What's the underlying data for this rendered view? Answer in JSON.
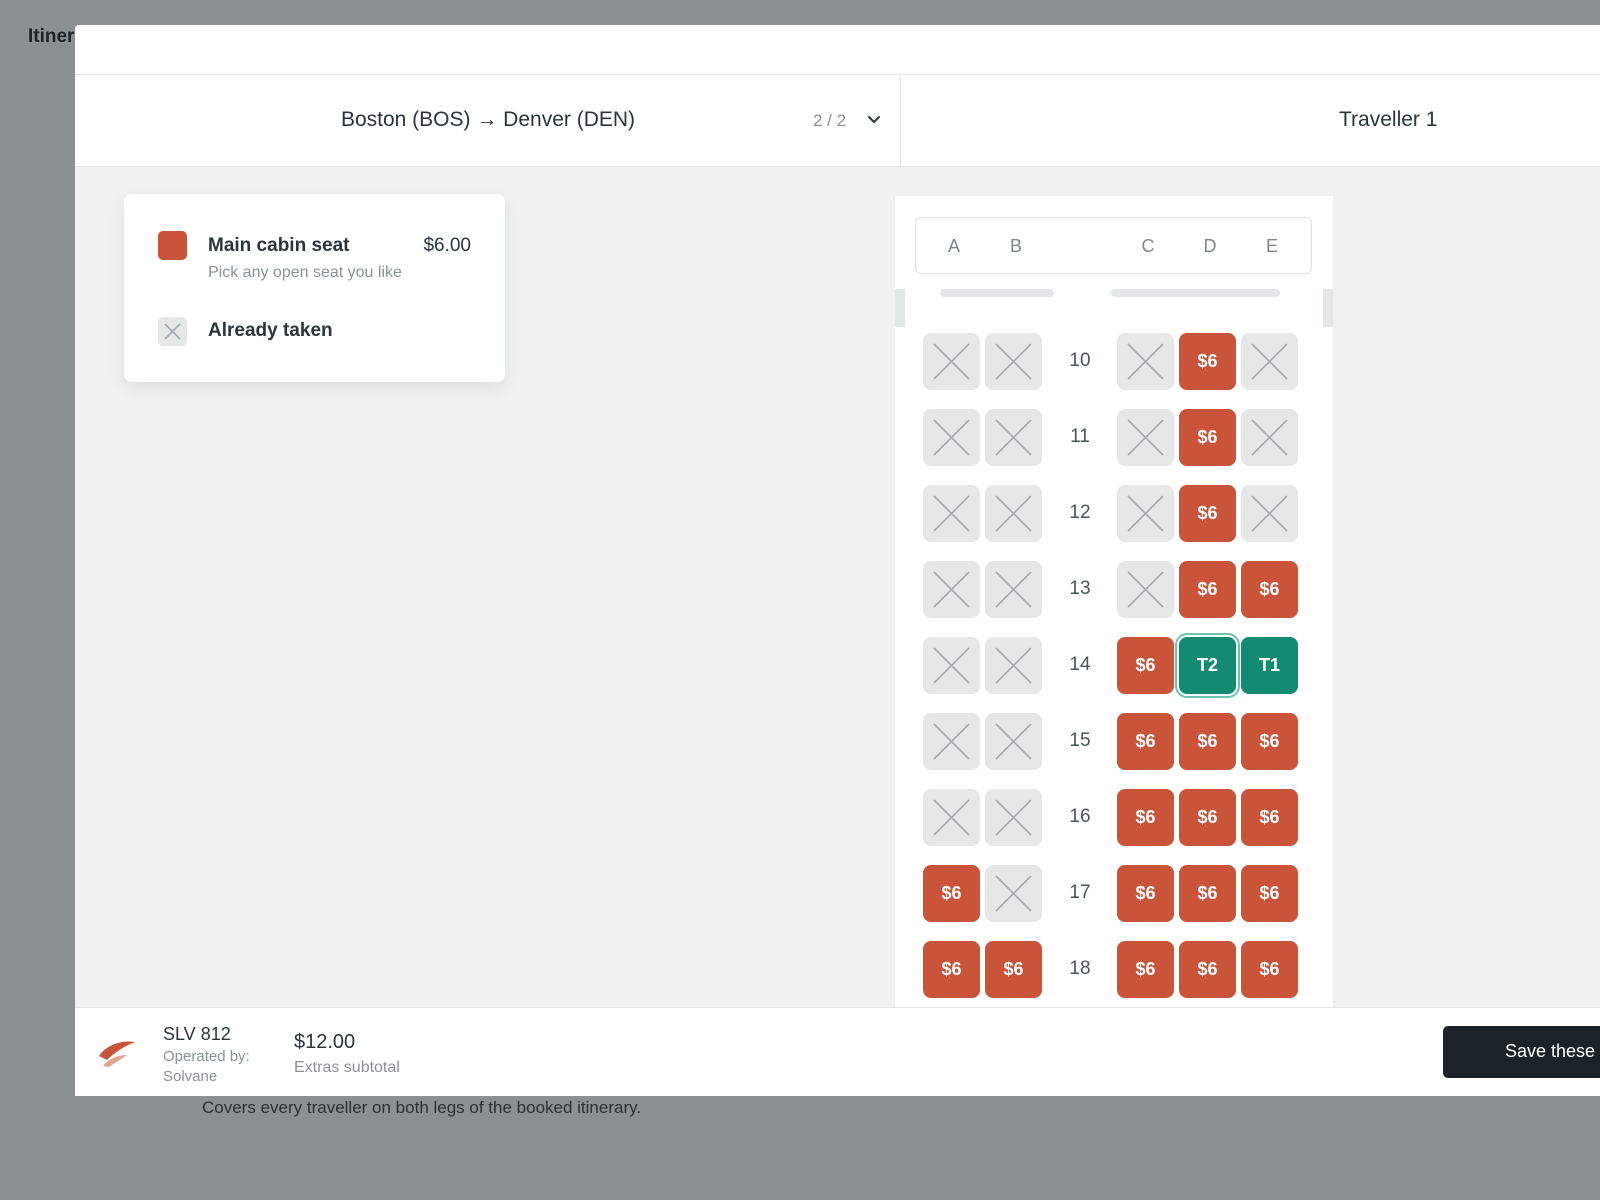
{
  "background": {
    "title": "Itiner",
    "note": "Covers every traveller on both legs of the booked itinerary."
  },
  "tabs": {
    "route": "Boston (BOS) → Denver (DEN)",
    "counter": "2 / 2",
    "traveller": "Traveller 1"
  },
  "legend": {
    "main_title": "Main cabin seat",
    "main_price": "$6.00",
    "main_sub": "Pick any open seat you like",
    "taken_label": "Already taken"
  },
  "seatmap": {
    "columns": [
      "A",
      "B",
      "C",
      "D",
      "E"
    ],
    "rows": [
      {
        "number": "10",
        "seats": [
          {
            "status": "taken"
          },
          {
            "status": "taken"
          },
          {
            "status": "taken"
          },
          {
            "status": "available",
            "label": "$6"
          },
          {
            "status": "taken"
          }
        ]
      },
      {
        "number": "11",
        "seats": [
          {
            "status": "taken"
          },
          {
            "status": "taken"
          },
          {
            "status": "taken"
          },
          {
            "status": "available",
            "label": "$6"
          },
          {
            "status": "taken"
          }
        ]
      },
      {
        "number": "12",
        "seats": [
          {
            "status": "taken"
          },
          {
            "status": "taken"
          },
          {
            "status": "taken"
          },
          {
            "status": "available",
            "label": "$6"
          },
          {
            "status": "taken"
          }
        ]
      },
      {
        "number": "13",
        "seats": [
          {
            "status": "taken"
          },
          {
            "status": "taken"
          },
          {
            "status": "taken"
          },
          {
            "status": "available",
            "label": "$6"
          },
          {
            "status": "available",
            "label": "$6"
          }
        ]
      },
      {
        "number": "14",
        "seats": [
          {
            "status": "taken"
          },
          {
            "status": "taken"
          },
          {
            "status": "available",
            "label": "$6"
          },
          {
            "status": "selected-active",
            "label": "T2"
          },
          {
            "status": "selected",
            "label": "T1"
          }
        ]
      },
      {
        "number": "15",
        "seats": [
          {
            "status": "taken"
          },
          {
            "status": "taken"
          },
          {
            "status": "available",
            "label": "$6"
          },
          {
            "status": "available",
            "label": "$6"
          },
          {
            "status": "available",
            "label": "$6"
          }
        ]
      },
      {
        "number": "16",
        "seats": [
          {
            "status": "taken"
          },
          {
            "status": "taken"
          },
          {
            "status": "available",
            "label": "$6"
          },
          {
            "status": "available",
            "label": "$6"
          },
          {
            "status": "available",
            "label": "$6"
          }
        ]
      },
      {
        "number": "17",
        "seats": [
          {
            "status": "available",
            "label": "$6"
          },
          {
            "status": "taken"
          },
          {
            "status": "available",
            "label": "$6"
          },
          {
            "status": "available",
            "label": "$6"
          },
          {
            "status": "available",
            "label": "$6"
          }
        ]
      },
      {
        "number": "18",
        "seats": [
          {
            "status": "available",
            "label": "$6"
          },
          {
            "status": "available",
            "label": "$6"
          },
          {
            "status": "available",
            "label": "$6"
          },
          {
            "status": "available",
            "label": "$6"
          },
          {
            "status": "available",
            "label": "$6"
          }
        ]
      }
    ]
  },
  "footer": {
    "flight_number": "SLV 812",
    "operated_by": "Operated by: Solvane",
    "subtotal": "$12.00",
    "subtotal_label": "Extras subtotal",
    "save_label": "Save these"
  },
  "colors": {
    "available": "#c9543a",
    "selected": "#138a72",
    "taken": "#e6e8e8",
    "primary_button": "#1b2328"
  },
  "icons": [
    "chevron-down-icon",
    "x-icon",
    "airline-logo-icon"
  ]
}
